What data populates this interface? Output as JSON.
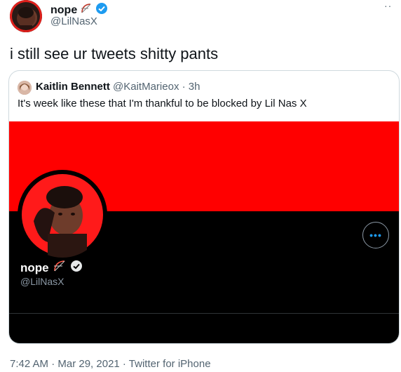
{
  "header": {
    "display_name": "nope",
    "handle": "@LilNasX",
    "more_label": "··",
    "icons": [
      "bow-arrow-icon",
      "verified-badge-icon"
    ]
  },
  "tweet": {
    "text": "i still see ur tweets shitty pants"
  },
  "quote": {
    "author_name": "Kaitlin Bennett",
    "author_handle_time": "@KaitMarieox · 3h",
    "text": "It's week like these that I'm thankful to be blocked by Lil Nas X",
    "image": {
      "profile_name": "nope",
      "profile_handle": "@LilNasX",
      "more_label": "•••",
      "banner_color": "#ff0000"
    }
  },
  "meta": {
    "timestamp_source": "7:42 AM · Mar 29, 2021 · Twitter for iPhone"
  },
  "colors": {
    "accent": "#1d9bf0",
    "secondary_text": "#536471",
    "border": "#cfd9de"
  }
}
